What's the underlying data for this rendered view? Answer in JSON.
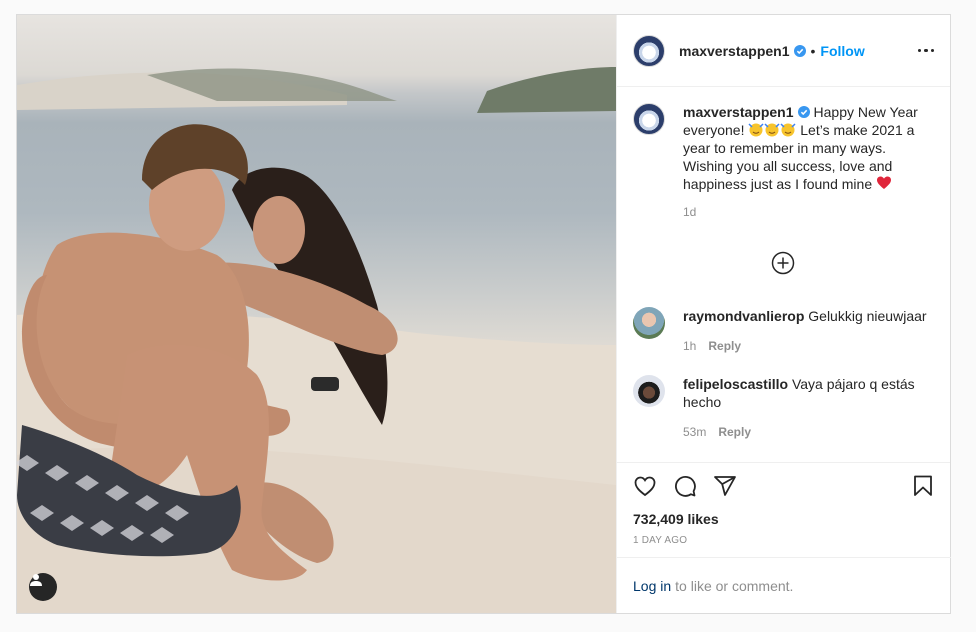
{
  "post": {
    "username": "maxverstappen1",
    "follow_label": "Follow",
    "caption_part1": "Happy New Year everyone!",
    "caption_part2": "Let’s make 2021 a year to remember in many ways. Wishing you all success, love and happiness just as I found mine",
    "caption_time": "1d"
  },
  "comments": [
    {
      "username": "raymondvanlierop",
      "text": "Gelukkig nieuwjaar",
      "time": "1h",
      "reply_label": "Reply"
    },
    {
      "username": "felipeloscastillo",
      "text": "Vaya pájaro q estás hecho",
      "time": "53m",
      "reply_label": "Reply"
    }
  ],
  "stats": {
    "likes": "732,409 likes",
    "date": "1 DAY AGO"
  },
  "login": {
    "link": "Log in",
    "suffix": "to like or comment."
  },
  "colors": {
    "accent": "#0095f6",
    "verified": "#3897f0",
    "heart": "#ed4956"
  },
  "icons": [
    "user-tag-icon",
    "verified-icon",
    "more-icon",
    "load-more-icon",
    "heart-icon",
    "comment-icon",
    "share-icon",
    "bookmark-icon"
  ]
}
